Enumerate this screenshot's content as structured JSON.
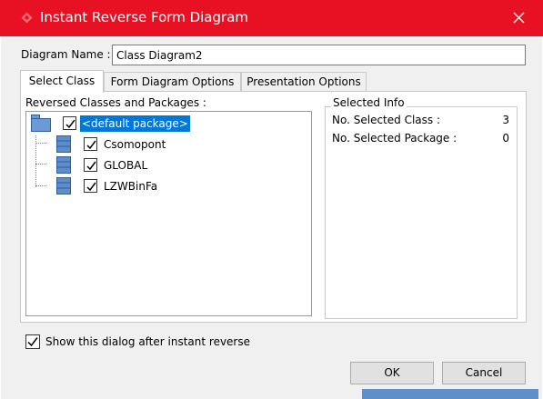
{
  "window": {
    "title": "Instant Reverse Form Diagram",
    "icon": "visual-paradigm-icon",
    "close_icon": "close-icon",
    "titlebar_color": "#e81123"
  },
  "form": {
    "diagram_name_label": "Diagram Name :",
    "diagram_name_value": "Class Diagram2"
  },
  "tabs": [
    {
      "label": "Select Class",
      "active": true
    },
    {
      "label": "Form Diagram Options",
      "active": false
    },
    {
      "label": "Presentation Options",
      "active": false
    }
  ],
  "tree": {
    "caption": "Reversed Classes and Packages :",
    "root": {
      "label": "<default package>",
      "checked": true,
      "selected": true,
      "icon": "package-icon"
    },
    "children": [
      {
        "label": "Csomopont",
        "checked": true,
        "icon": "class-icon"
      },
      {
        "label": "GLOBAL",
        "checked": true,
        "icon": "class-icon"
      },
      {
        "label": "LZWBinFa",
        "checked": true,
        "icon": "class-icon"
      }
    ]
  },
  "selected_info": {
    "caption": "Selected Info",
    "rows": [
      {
        "label": "No. Selected Class :",
        "value": "3"
      },
      {
        "label": "No. Selected Package :",
        "value": "0"
      }
    ]
  },
  "options": {
    "show_dialog_label": "Show this dialog after instant reverse",
    "show_dialog_checked": true
  },
  "buttons": {
    "ok": "OK",
    "cancel": "Cancel"
  },
  "colors": {
    "selection": "#0078d7",
    "icon_blue": "#4a7fc0"
  }
}
